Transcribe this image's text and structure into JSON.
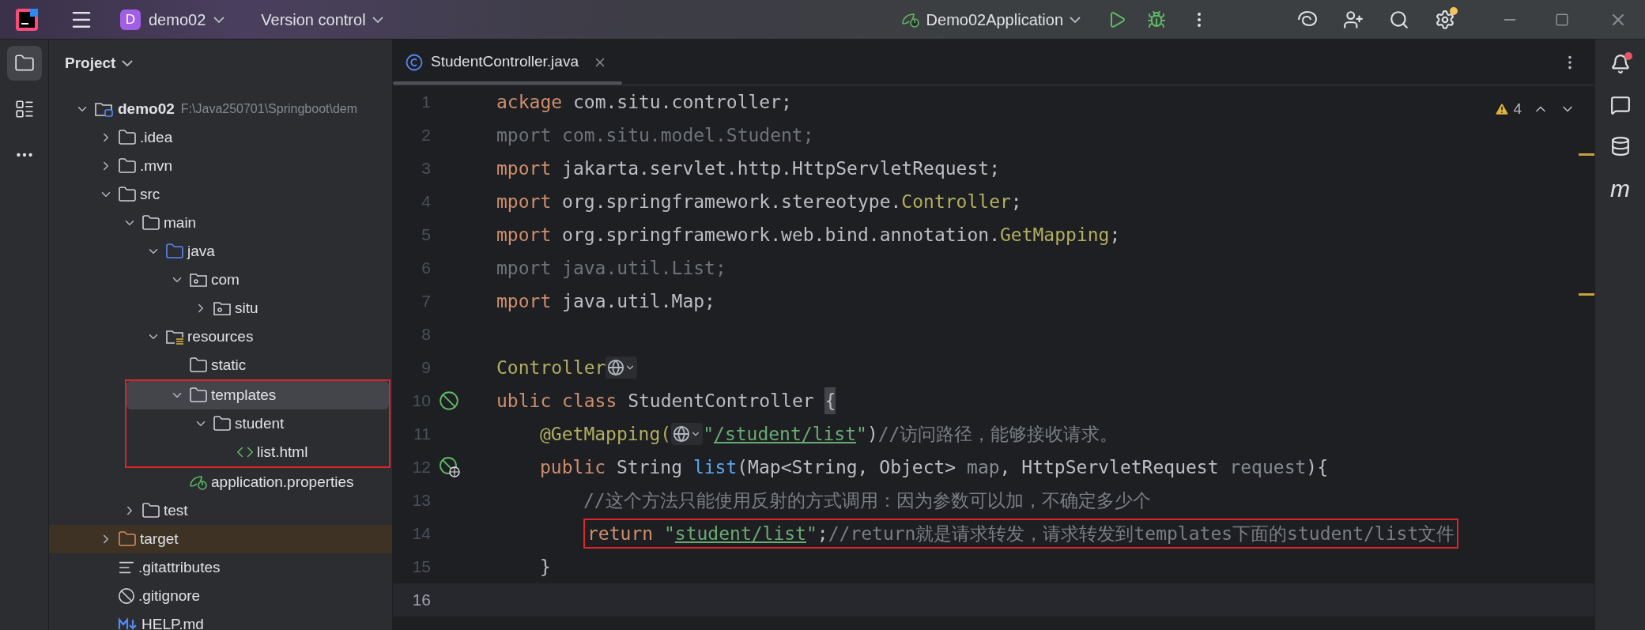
{
  "title_bar": {
    "project_initial": "D",
    "project": "demo02",
    "vcs": "Version control",
    "run_config": "Demo02Application",
    "update_available": true
  },
  "left_toolbar": [
    {
      "kind": "project",
      "selected": true
    },
    {
      "kind": "structure",
      "selected": false
    },
    {
      "kind": "more",
      "selected": false
    }
  ],
  "project_panel": {
    "title": "Project",
    "tree": [
      {
        "label": "demo02",
        "kind": "module",
        "path": "F:\\Java250701\\Springboot\\dem",
        "expanded": true,
        "selected": false,
        "children": [
          {
            "label": ".idea",
            "kind": "folder",
            "expanded": false,
            "selected": false
          },
          {
            "label": ".mvn",
            "kind": "folder",
            "expanded": false,
            "selected": false
          },
          {
            "label": "src",
            "kind": "folder",
            "expanded": true,
            "selected": false,
            "children": [
              {
                "label": "main",
                "kind": "folder",
                "expanded": true,
                "selected": false,
                "children": [
                  {
                    "label": "java",
                    "kind": "source-folder",
                    "expanded": true,
                    "selected": false,
                    "children": [
                      {
                        "label": "com",
                        "kind": "package",
                        "expanded": true,
                        "selected": false,
                        "children": [
                          {
                            "label": "situ",
                            "kind": "package",
                            "expanded": false,
                            "selected": false
                          }
                        ]
                      }
                    ]
                  },
                  {
                    "label": "resources",
                    "kind": "resources",
                    "expanded": true,
                    "selected": false,
                    "children": [
                      {
                        "label": "static",
                        "kind": "folder",
                        "selected": false
                      },
                      {
                        "label": "templates",
                        "kind": "folder",
                        "expanded": true,
                        "selected": true,
                        "annotated": true,
                        "children": [
                          {
                            "label": "student",
                            "kind": "folder",
                            "expanded": true,
                            "selected": false,
                            "children": [
                              {
                                "label": "list.html",
                                "kind": "html",
                                "selected": false
                              }
                            ]
                          }
                        ]
                      },
                      {
                        "label": "application.properties",
                        "kind": "spring",
                        "selected": false
                      }
                    ]
                  }
                ]
              },
              {
                "label": "test",
                "kind": "folder",
                "expanded": false,
                "selected": false
              }
            ]
          },
          {
            "label": "target",
            "kind": "excluded",
            "expanded": false,
            "selected": false
          },
          {
            "label": ".gitattributes",
            "kind": "text",
            "selected": false
          },
          {
            "label": ".gitignore",
            "kind": "ignore",
            "selected": false
          },
          {
            "label": "HELP.md",
            "kind": "markdown",
            "selected": false
          }
        ]
      }
    ]
  },
  "editor": {
    "tabs": [
      {
        "label": "StudentController.java",
        "selected": true
      }
    ],
    "warnings": "4",
    "lines": [
      {
        "number": "1",
        "tokens": [
          {
            "kind": "kw",
            "text": "ackage"
          },
          {
            "kind": "plain",
            "text": " com.situ.controller;"
          }
        ]
      },
      {
        "number": "2",
        "tokens": [
          {
            "kind": "unused",
            "text": "mport com.situ.model.Student;"
          }
        ]
      },
      {
        "number": "3",
        "tokens": [
          {
            "kind": "kw",
            "text": "mport"
          },
          {
            "kind": "plain",
            "text": " jakarta.servlet.http.HttpServletRequest;"
          }
        ]
      },
      {
        "number": "4",
        "tokens": [
          {
            "kind": "kw",
            "text": "mport"
          },
          {
            "kind": "plain",
            "text": " org.springframework.stereotype."
          },
          {
            "kind": "annotation",
            "text": "Controller"
          },
          {
            "kind": "plain",
            "text": ";"
          }
        ]
      },
      {
        "number": "5",
        "tokens": [
          {
            "kind": "kw",
            "text": "mport"
          },
          {
            "kind": "plain",
            "text": " org.springframework.web.bind.annotation."
          },
          {
            "kind": "annotation",
            "text": "GetMapping"
          },
          {
            "kind": "plain",
            "text": ";"
          }
        ]
      },
      {
        "number": "6",
        "tokens": [
          {
            "kind": "unused",
            "text": "mport java.util.List;"
          }
        ]
      },
      {
        "number": "7",
        "tokens": [
          {
            "kind": "kw",
            "text": "mport"
          },
          {
            "kind": "plain",
            "text": " java.util.Map;"
          }
        ]
      },
      {
        "number": "8"
      },
      {
        "number": "9",
        "tokens": [
          {
            "kind": "annotation",
            "text": "Controller"
          },
          {
            "kind": "inlay"
          }
        ]
      },
      {
        "number": "10",
        "gutter": {
          "kind": "bean"
        },
        "tokens": [
          {
            "kind": "kw",
            "text": "ublic class"
          },
          {
            "kind": "plain",
            "text": " StudentController "
          },
          {
            "kind": "brace",
            "text": "{"
          }
        ]
      },
      {
        "number": "11",
        "tokens": [
          {
            "kind": "indent"
          },
          {
            "kind": "annotation",
            "text": "@GetMapping("
          },
          {
            "kind": "inlay"
          },
          {
            "kind": "string",
            "text": "\""
          },
          {
            "kind": "link",
            "text": "/student/list"
          },
          {
            "kind": "string",
            "text": "\""
          },
          {
            "kind": "plain",
            "text": ")"
          },
          {
            "kind": "comment",
            "text": "//访问路径，能够接收请求。"
          }
        ]
      },
      {
        "number": "12",
        "gutter": {
          "kind": "endpoint"
        },
        "tokens": [
          {
            "kind": "indent"
          },
          {
            "kind": "kw",
            "text": "public"
          },
          {
            "kind": "plain",
            "text": " String "
          },
          {
            "kind": "method",
            "text": "list"
          },
          {
            "kind": "plain",
            "text": "(Map<String, Object> "
          },
          {
            "kind": "param",
            "text": "map"
          },
          {
            "kind": "plain",
            "text": ", HttpServletRequest "
          },
          {
            "kind": "param",
            "text": "request"
          },
          {
            "kind": "plain",
            "text": "){"
          }
        ]
      },
      {
        "number": "13",
        "tokens": [
          {
            "kind": "indent"
          },
          {
            "kind": "indent"
          },
          {
            "kind": "comment",
            "text": "//这个方法只能使用反射的方式调用：因为参数可以加，不确定多少个"
          }
        ]
      },
      {
        "number": "14",
        "annotated": true,
        "tokens": [
          {
            "kind": "indent"
          },
          {
            "kind": "indent"
          },
          {
            "kind": "kw",
            "text": "return"
          },
          {
            "kind": "string",
            "text": " \""
          },
          {
            "kind": "link",
            "text": "student/list"
          },
          {
            "kind": "string",
            "text": "\""
          },
          {
            "kind": "plain",
            "text": ";"
          },
          {
            "kind": "comment",
            "text": "//return就是请求转发，请求转发到templates下面的student/list文件"
          }
        ]
      },
      {
        "number": "15",
        "tokens": [
          {
            "kind": "indent"
          },
          {
            "kind": "plain",
            "text": "}"
          }
        ]
      },
      {
        "number": "16",
        "current": true
      }
    ]
  },
  "right_toolbar": [
    {
      "kind": "notifications",
      "unread": true
    },
    {
      "kind": "ai-chat"
    },
    {
      "kind": "database"
    },
    {
      "kind": "maven",
      "glyph": "m"
    }
  ]
}
